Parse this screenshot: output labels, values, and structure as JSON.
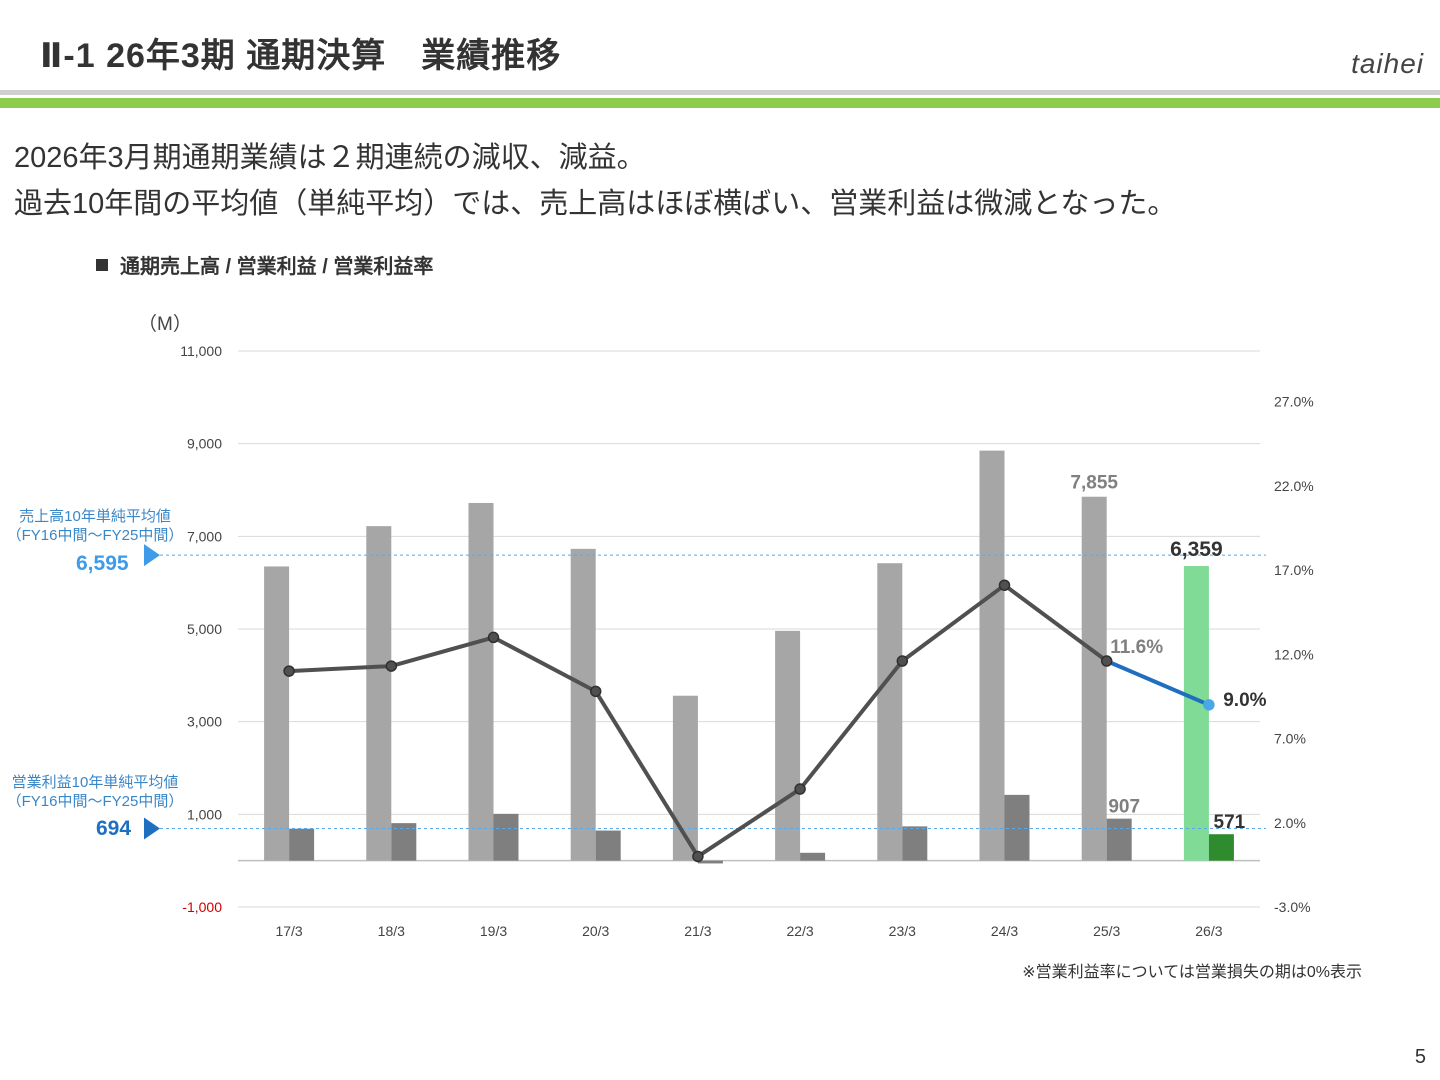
{
  "header": {
    "title": "Ⅱ-1 26年3期 通期決算　業績推移",
    "brand": "taihei"
  },
  "summary": {
    "line1": "2026年3月期通期業績は２期連続の減収、減益。",
    "line2": "過去10年間の平均値（単純平均）では、売上高はほぼ横ばい、営業利益は微減となった。"
  },
  "chart_heading": "通期売上高 / 営業利益 / 営業利益率",
  "annotations": {
    "sales_avg_label_1": "売上高10年単純平均値",
    "sales_avg_label_2": "（FY16中間～FY25中間）",
    "sales_avg_value": "6,595",
    "op_avg_label_1": "営業利益10年単純平均値",
    "op_avg_label_2": "（FY16中間～FY25中間）",
    "op_avg_value": "694"
  },
  "colors": {
    "sales_bar": "#a6a6a6",
    "op_bar": "#7f7f7f",
    "sales_bar_latest": "#80db96",
    "op_bar_latest": "#2e8b2e",
    "margin_line": "#505050",
    "margin_line_latest": "#1f6fc0",
    "margin_point_latest": "#4aa8e6",
    "avg_line": "#5aa9e6",
    "sales_avg_accent": "#3d9be9",
    "op_avg_accent": "#1f6fc0",
    "negative_tick": "#d00000"
  },
  "chart_data": {
    "type": "bar",
    "unit": "（M）",
    "categories": [
      "17/3",
      "18/3",
      "19/3",
      "20/3",
      "21/3",
      "22/3",
      "23/3",
      "24/3",
      "25/3",
      "26/3"
    ],
    "series": [
      {
        "name": "通期売上高",
        "type": "bar",
        "axis": "left",
        "values": [
          6350,
          7220,
          7720,
          6730,
          3560,
          4960,
          6420,
          8850,
          7855,
          6359
        ]
      },
      {
        "name": "営業利益",
        "type": "bar",
        "axis": "left",
        "values": [
          690,
          810,
          1010,
          650,
          -60,
          170,
          740,
          1420,
          907,
          571
        ]
      },
      {
        "name": "営業利益率",
        "type": "line",
        "axis": "right",
        "values": [
          11.0,
          11.3,
          13.0,
          9.8,
          0.0,
          4.0,
          11.6,
          16.1,
          11.6,
          9.0
        ]
      }
    ],
    "data_labels": {
      "sales_25_3": "7,855",
      "sales_26_3": "6,359",
      "op_25_3": "907",
      "op_26_3": "571",
      "margin_25_3": "11.6%",
      "margin_26_3": "9.0%"
    },
    "averages": {
      "sales": 6595,
      "operating_profit": 694
    },
    "y_left": {
      "range": [
        -1000,
        11000
      ],
      "ticks": [
        11000,
        9000,
        7000,
        5000,
        3000,
        1000,
        -1000
      ],
      "tick_labels": [
        "11,000",
        "9,000",
        "7,000",
        "5,000",
        "3,000",
        "1,000",
        "-1,000"
      ]
    },
    "y_right": {
      "range": [
        -3.0,
        30.0
      ],
      "ticks": [
        27.0,
        22.0,
        17.0,
        12.0,
        7.0,
        2.0,
        -3.0
      ],
      "tick_labels": [
        "27.0%",
        "22.0%",
        "17.0%",
        "12.0%",
        "7.0%",
        "2.0%",
        "-3.0%"
      ]
    },
    "grid": true
  },
  "footnote": "※営業利益率については営業損失の期は0%表示",
  "page_number": "5"
}
